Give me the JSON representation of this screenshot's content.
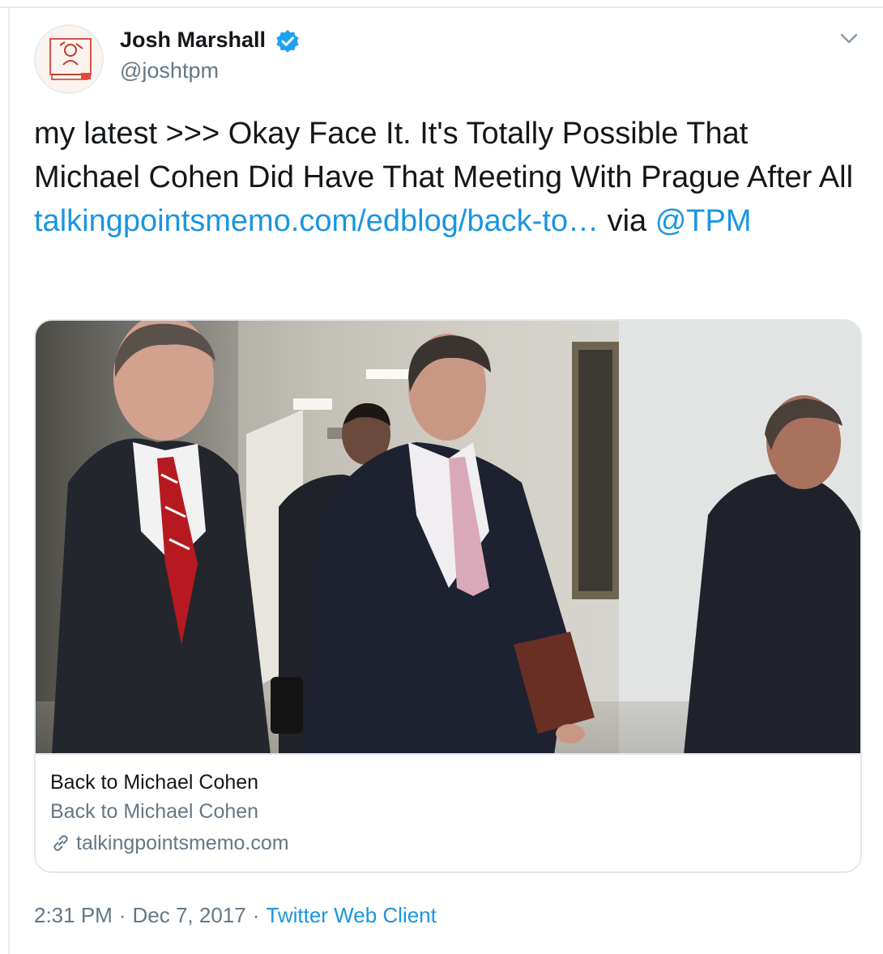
{
  "author": {
    "name": "Josh Marshall",
    "handle": "@joshtpm",
    "verified": true,
    "avatar_icon": "cartoon-avatar-icon"
  },
  "menu": {
    "icon": "chevron-down-icon"
  },
  "tweet": {
    "text_prefix": "my latest >>> Okay Face It. It's Totally Possible That Michael Cohen Did Have That Meeting With Prague After All ",
    "link_text": "talkingpointsmemo.com/edblog/back-to…",
    "text_via": " via ",
    "mention": "@TPM"
  },
  "card": {
    "image_description_icon": "news-photo",
    "title": "Back to Michael Cohen",
    "description": "Back to Michael Cohen",
    "domain": "talkingpointsmemo.com",
    "domain_icon": "link-icon"
  },
  "meta": {
    "time": "2:31 PM",
    "separator": "·",
    "date": "Dec 7, 2017",
    "client": "Twitter Web Client"
  },
  "colors": {
    "link": "#1b95e0",
    "secondary_text": "#657786",
    "primary_text": "#14171a",
    "border": "#e1e8ed",
    "verified_badge": "#1da1f2"
  }
}
